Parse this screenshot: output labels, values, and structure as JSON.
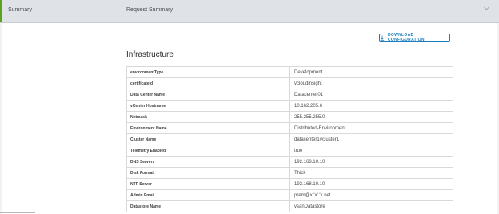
{
  "header": {
    "step1": "Summary",
    "step2": "Request Summary"
  },
  "download_button": {
    "label": "DOWNLOAD CONFIGURATION",
    "icon": "download-icon"
  },
  "section": {
    "title": "Infrastructure"
  },
  "rows": [
    {
      "key": "environmentType",
      "value": "Development"
    },
    {
      "key": "certificateId",
      "value": "vcloudinsight"
    },
    {
      "key": "Data Center Name",
      "value": "Datacenter01"
    },
    {
      "key": "vCenter Hostname",
      "value": "10.162.205.6"
    },
    {
      "key": "Netmask",
      "value": "255.255.255.0"
    },
    {
      "key": "Environment Name",
      "value": "Distributed-Environment"
    },
    {
      "key": "Cluster Name",
      "value": "datacenter1#cluster1"
    },
    {
      "key": "Telemetry Enabled",
      "value": "true"
    },
    {
      "key": "DNS Servers",
      "value": "192.168.10.10"
    },
    {
      "key": "Disk Format",
      "value": "Thick"
    },
    {
      "key": "NTP Server",
      "value": "192.168.10.10"
    },
    {
      "key": "Admin Email",
      "value": "prem@x  'x'  'x.net"
    },
    {
      "key": "Datastore Name",
      "value": "vsanDatastore"
    }
  ],
  "colors": {
    "accent_green": "#5aa220",
    "link_blue": "#1a7ec1",
    "header_bg": "#dfe3e8"
  }
}
